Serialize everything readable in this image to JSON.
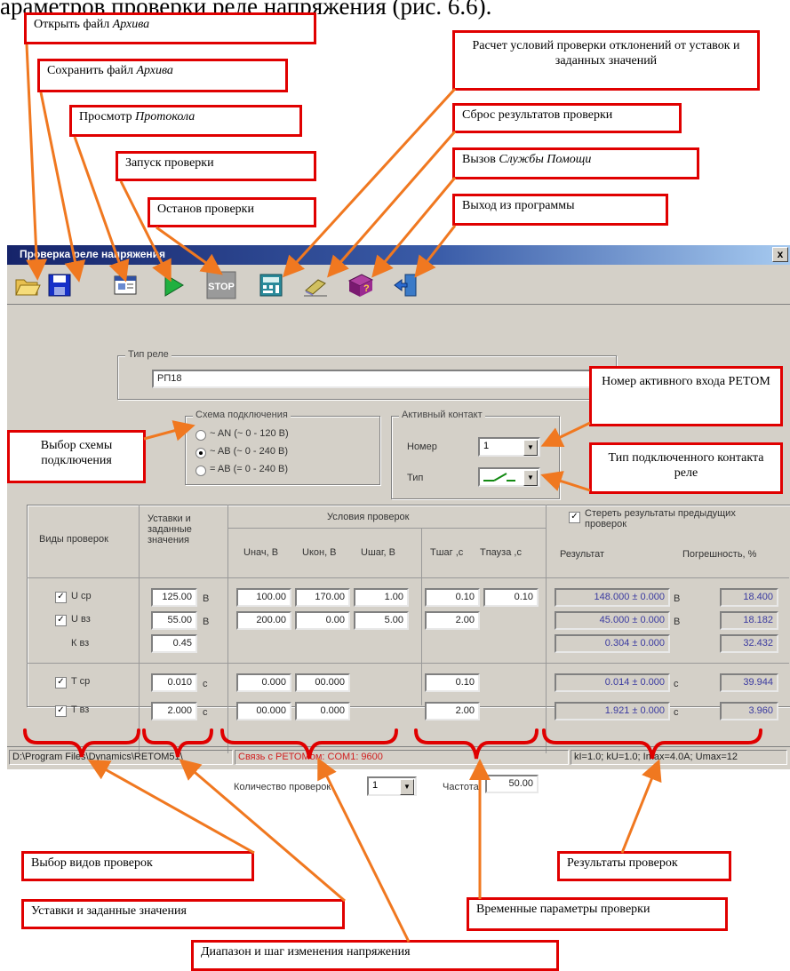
{
  "heading_fragment": "араметров проверки реле напряжения (рис. 6.6).",
  "callouts": {
    "open_prefix": "Открыть файл",
    "open_italic": "Архива",
    "save_prefix": "Сохранить файл",
    "save_italic": "Архива",
    "protocol_prefix": "Просмотр",
    "protocol_italic": "Протокола",
    "start": "Запуск проверки",
    "stop": "Останов проверки",
    "calc": "Расчет условий проверки отклонений от уставок и заданных значений",
    "reset": "Сброс результатов проверки",
    "help_prefix": "Вызов",
    "help_italic": "Службы Помощи",
    "exit": "Выход из программы",
    "input_number": "Номер активного входа РЕТОМ",
    "scheme": "Выбор схемы подключения",
    "contact_type": "Тип подключенного контакта реле",
    "check_types": "Выбор видов проверок",
    "settings": "Уставки и заданные значения",
    "range": "Диапазон и шаг изменения напряжения",
    "results": "Результаты проверок",
    "time_params": "Временные параметры проверки"
  },
  "window": {
    "title": "Проверка реле напряжения",
    "close": "x",
    "relay_type_group": "Тип реле",
    "relay_type_value": "РП18",
    "scheme_group": "Схема подключения",
    "scheme_options": [
      "~ AN (~ 0 - 120 В)",
      "~ AB (~ 0 - 240 В)",
      "= AB (= 0 - 240 В)"
    ],
    "scheme_selected": 1,
    "contact_group": "Активный контакт",
    "contact_number_label": "Номер",
    "contact_number_value": "1",
    "contact_type_label": "Тип",
    "col_types": "Виды проверок",
    "col_settings": "Уставки и заданные значения",
    "col_conditions": "Условия проверок",
    "sub_unach": "Uнач, В",
    "sub_ukon": "Uкон, В",
    "sub_ushag": "Uшаг, В",
    "sub_tshag": "Tшаг ,с",
    "sub_tpause": "Tпауза ,с",
    "clear_results": "Стереть результаты предыдущих проверок",
    "col_result": "Результат",
    "col_error": "Погрешность, %",
    "rows": [
      {
        "name": "U ср",
        "checked": true,
        "setting": "125.00",
        "unit": "В",
        "unach": "100.00",
        "ukon": "170.00",
        "ushag": "1.00",
        "tshag": "0.10",
        "tpause": "0.10",
        "result": "148.000 ± 0.000",
        "runit": "В",
        "error": "18.400"
      },
      {
        "name": "U вз",
        "checked": true,
        "setting": "55.00",
        "unit": "В",
        "unach": "200.00",
        "ukon": "0.00",
        "ushag": "5.00",
        "tshag": "2.00",
        "tpause": "",
        "result": "45.000 ± 0.000",
        "runit": "В",
        "error": "18.182"
      },
      {
        "name": "К вз",
        "checked": false,
        "setting": "0.45",
        "unit": "",
        "unach": "",
        "ukon": "",
        "ushag": "",
        "tshag": "",
        "tpause": "",
        "result": "0.304 ± 0.000",
        "runit": "",
        "error": "32.432"
      },
      {
        "name": "T ср",
        "checked": true,
        "setting": "0.010",
        "unit": "с",
        "unach": "0.000",
        "ukon": "00.000",
        "ushag": "",
        "tshag": "0.10",
        "tpause": "",
        "result": "0.014 ± 0.000",
        "runit": "с",
        "error": "39.944"
      },
      {
        "name": "T вз",
        "checked": true,
        "setting": "2.000",
        "unit": "с",
        "unach": "00.000",
        "ukon": "0.000",
        "ushag": "",
        "tshag": "2.00",
        "tpause": "",
        "result": "1.921 ± 0.000",
        "runit": "с",
        "error": "3.960"
      }
    ],
    "count_label": "Количество проверок",
    "count_value": "1",
    "freq_label": "Частота",
    "freq_value": "50.00",
    "status_path": "D:\\Program Files\\Dynamics\\RETOM51\\",
    "status_link": "Связь с РЕТОМом: COM1: 9600",
    "status_params": "kI=1.0; kU=1.0; Imax=4.0A; Umax=12"
  },
  "colors": {
    "callout_border": "#e00000",
    "arrow": "#f07820",
    "window_face": "#d4d0c8"
  }
}
